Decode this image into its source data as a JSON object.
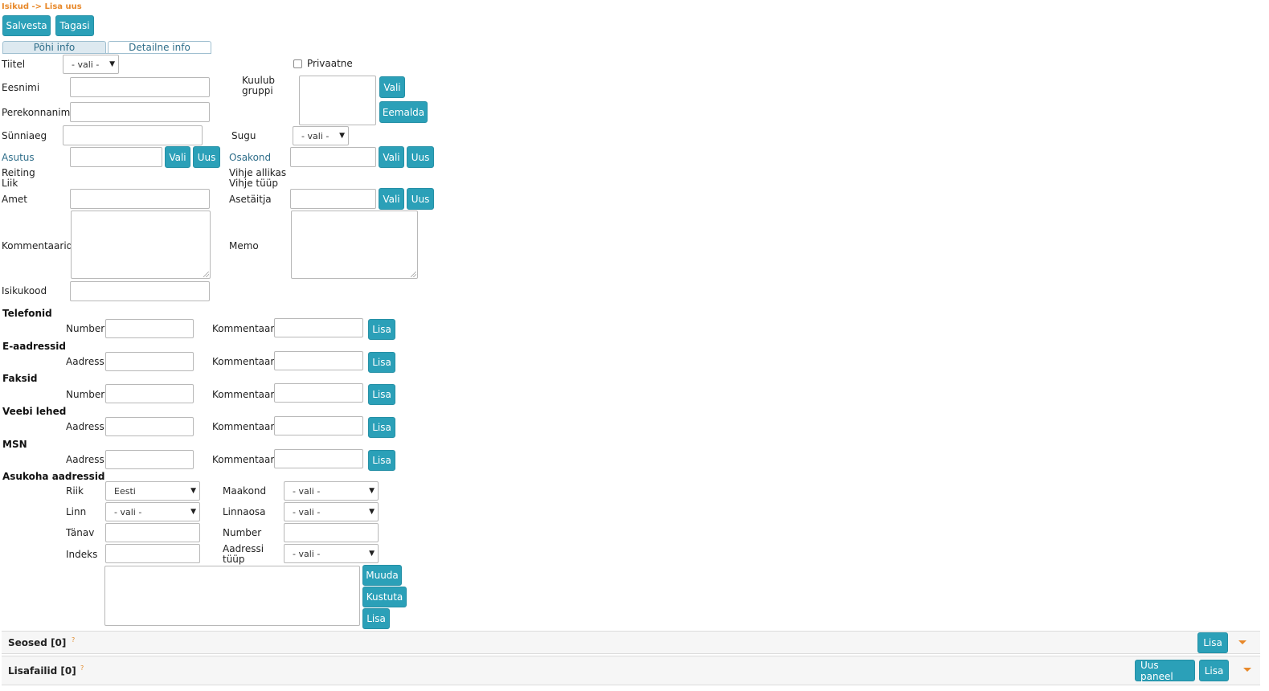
{
  "breadcrumb": "Isikud -> Lisa uus",
  "toolbar": {
    "save": "Salvesta",
    "back": "Tagasi"
  },
  "tabs": {
    "basic": "Põhi info",
    "detail": "Detailne info"
  },
  "select_default": "- vali -",
  "form": {
    "title_label": "Tiitel",
    "private_label": "Privaatne",
    "firstname_label": "Eesnimi",
    "group_label_1": "Kuulub",
    "group_label_2": "gruppi",
    "lastname_label": "Perekonnanimi",
    "birthdate_label": "Sünniaeg",
    "gender_label": "Sugu",
    "org_label": "Asutus",
    "dept_label": "Osakond",
    "rating_label": "Reiting",
    "type_label": "Liik",
    "lead_source_label": "Vihje allikas",
    "lead_type_label": "Vihje tüüp",
    "position_label": "Amet",
    "deputy_label": "Asetäitja",
    "comments_label": "Kommentaarid",
    "memo_label": "Memo",
    "idcode_label": "Isikukood",
    "choose_btn": "Vali",
    "new_btn": "Uus",
    "remove_btn": "Eemalda"
  },
  "contacts": {
    "comment_label": "Kommentaar",
    "add_btn": "Lisa",
    "sections": [
      {
        "title": "Telefonid",
        "field": "Number"
      },
      {
        "title": "E-aadressid",
        "field": "Aadress"
      },
      {
        "title": "Faksid",
        "field": "Number"
      },
      {
        "title": "Veebi lehed",
        "field": "Aadress"
      },
      {
        "title": "MSN",
        "field": "Aadress"
      }
    ]
  },
  "address": {
    "title": "Asukoha aadressid",
    "country_label": "Riik",
    "country_value": "Eesti",
    "county_label": "Maakond",
    "city_label": "Linn",
    "district_label": "Linnaosa",
    "street_label": "Tänav",
    "number_label": "Number",
    "index_label": "Indeks",
    "addr_type_label_1": "Aadressi",
    "addr_type_label_2": "tüüp",
    "edit_btn": "Muuda",
    "delete_btn": "Kustuta",
    "add_btn": "Lisa"
  },
  "panels": {
    "relations": "Seosed [0]",
    "attachments": "Lisafailid [0]",
    "help": "?",
    "add_btn": "Lisa",
    "new_panel_btn": "Uus paneel"
  },
  "colors": {
    "accent": "#2ba0b8",
    "breadcrumb": "#e8892b",
    "link": "#2f6e8a"
  }
}
